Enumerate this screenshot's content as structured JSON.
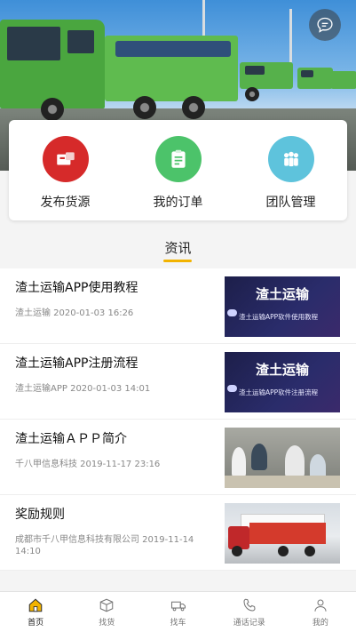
{
  "hero": {
    "chat_icon": "chat-bubble-icon"
  },
  "quick_menu": [
    {
      "label": "发布货源",
      "icon": "cargo-box-icon",
      "color": "#d62a2a"
    },
    {
      "label": "我的订单",
      "icon": "clipboard-icon",
      "color": "#4cc36a"
    },
    {
      "label": "团队管理",
      "icon": "team-icon",
      "color": "#5ec3dc"
    }
  ],
  "news": {
    "section_title": "资讯",
    "accent": "#f2b300",
    "items": [
      {
        "title": "渣土运输APP使用教程",
        "meta": "渣土运输 2020-01-03 16:26",
        "thumb_title": "渣土运输",
        "thumb_sub": "渣土运输APP软件使用教程"
      },
      {
        "title": "渣土运输APP注册流程",
        "meta": "渣土运输APP 2020-01-03 14:01",
        "thumb_title": "渣土运输",
        "thumb_sub": "渣土运输APP软件注册流程"
      },
      {
        "title": "渣土运输ＡＰＰ简介",
        "meta": "千八甲信息科技 2019-11-17 23:16"
      },
      {
        "title": "奖励规则",
        "meta": "成都市千八甲信息科技有限公司 2019-11-14 14:10"
      }
    ]
  },
  "tabbar": [
    {
      "label": "首页",
      "icon": "home-icon",
      "active": true
    },
    {
      "label": "找货",
      "icon": "box-icon"
    },
    {
      "label": "找车",
      "icon": "truck-icon"
    },
    {
      "label": "通话记录",
      "icon": "phone-icon"
    },
    {
      "label": "我的",
      "icon": "user-icon"
    }
  ]
}
